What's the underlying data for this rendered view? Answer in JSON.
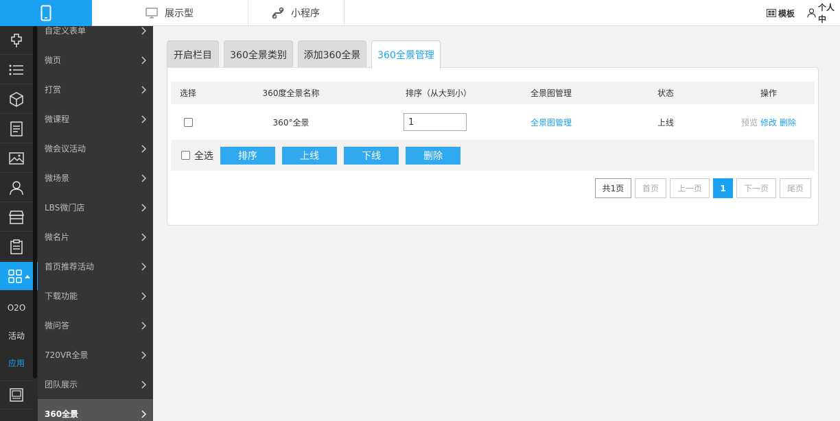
{
  "header": {
    "tabs": [
      {
        "label": "展示型",
        "icon": "monitor-icon"
      },
      {
        "label": "小程序",
        "icon": "mini-program-icon"
      }
    ],
    "template_label": "模板",
    "user_label": "个人中"
  },
  "rail": {
    "icons": [
      "plugin-icon",
      "list-icon",
      "cube-icon",
      "document-icon",
      "image-icon",
      "user-icon",
      "store-icon",
      "clipboard-icon",
      "apps-grid-icon",
      "picture-frame-icon"
    ],
    "texts": [
      "O2O",
      "活动",
      "应用"
    ]
  },
  "submenu": {
    "items": [
      "自定义表单",
      "微页",
      "打赏",
      "微课程",
      "微会议活动",
      "微场景",
      "LBS微门店",
      "微名片",
      "首页推荐活动",
      "下载功能",
      "微问答",
      "720VR全景",
      "团队展示",
      "360全景"
    ],
    "active_index": 13
  },
  "tabs": [
    "开启栏目",
    "360全景类别",
    "添加360全景",
    "360全景管理"
  ],
  "table": {
    "headers": [
      "选择",
      "360度全景名称",
      "排序（从大到小）",
      "全景图管理",
      "状态",
      "操作"
    ],
    "rows": [
      {
        "name": "360°全景",
        "sort": "1",
        "manage": "全景图管理",
        "status": "上线",
        "preview": "预览",
        "edit": "修改",
        "delete": "删除"
      }
    ]
  },
  "actions": {
    "select_all": "全选",
    "buttons": [
      "排序",
      "上线",
      "下线",
      "删除"
    ]
  },
  "pagination": {
    "total": "共1页",
    "first": "首页",
    "prev": "上一页",
    "current": "1",
    "next": "下一页",
    "last": "尾页"
  },
  "colors": {
    "accent": "#1aa1ef",
    "button": "#30a9f0",
    "sidebar": "#353535"
  }
}
